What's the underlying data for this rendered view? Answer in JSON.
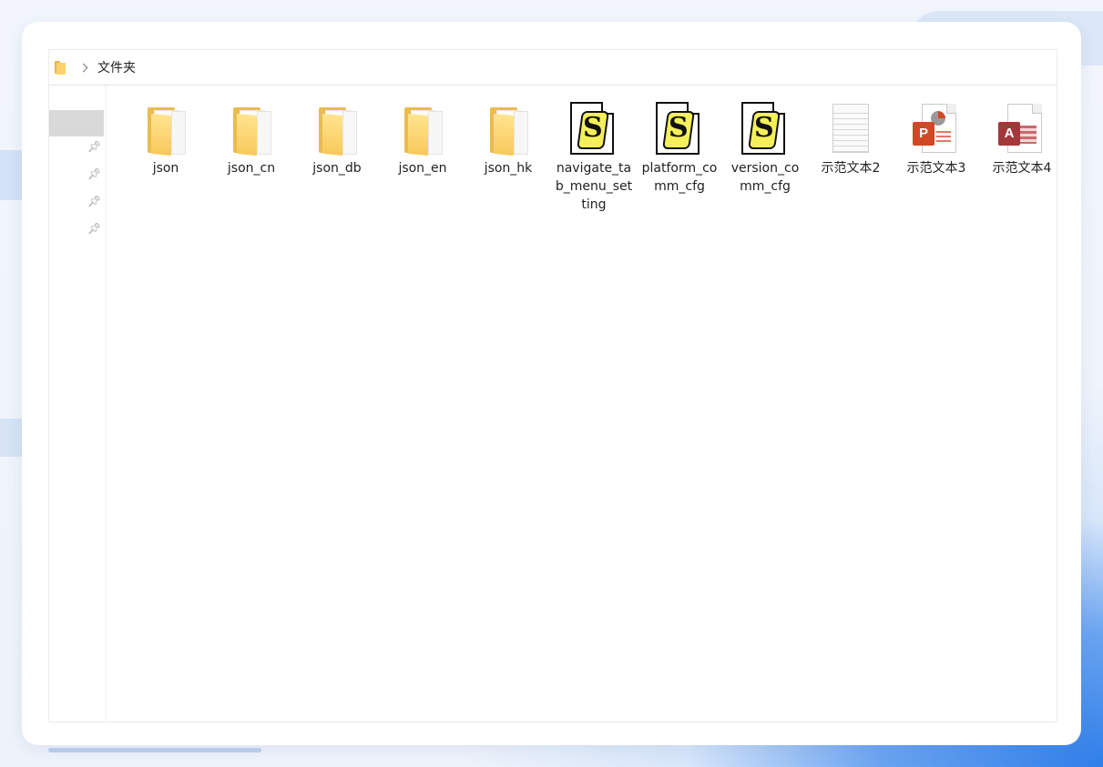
{
  "breadcrumb": {
    "current": "文件夹"
  },
  "items": [
    {
      "name": "json",
      "type": "folder",
      "icon": "folder-icon"
    },
    {
      "name": "json_cn",
      "type": "folder",
      "icon": "folder-icon"
    },
    {
      "name": "json_db",
      "type": "folder",
      "icon": "folder-icon"
    },
    {
      "name": "json_en",
      "type": "folder",
      "icon": "folder-icon"
    },
    {
      "name": "json_hk",
      "type": "folder",
      "icon": "folder-icon"
    },
    {
      "name": "navigate_tab_menu_setting",
      "type": "cfg",
      "icon": "script-file-icon"
    },
    {
      "name": "platform_comm_cfg",
      "type": "cfg",
      "icon": "script-file-icon"
    },
    {
      "name": "version_comm_cfg",
      "type": "cfg",
      "icon": "script-file-icon"
    },
    {
      "name": "示范文本2",
      "type": "txt",
      "icon": "text-file-icon"
    },
    {
      "name": "示范文本3",
      "type": "ppt",
      "icon": "powerpoint-file-icon",
      "badge": "P"
    },
    {
      "name": "示范文本4",
      "type": "access",
      "icon": "access-file-icon",
      "badge": "A"
    }
  ],
  "colors": {
    "folder": "#fad36a",
    "powerpoint": "#d24726",
    "access": "#a4373a",
    "nav_selected": "#d9d9d9"
  }
}
